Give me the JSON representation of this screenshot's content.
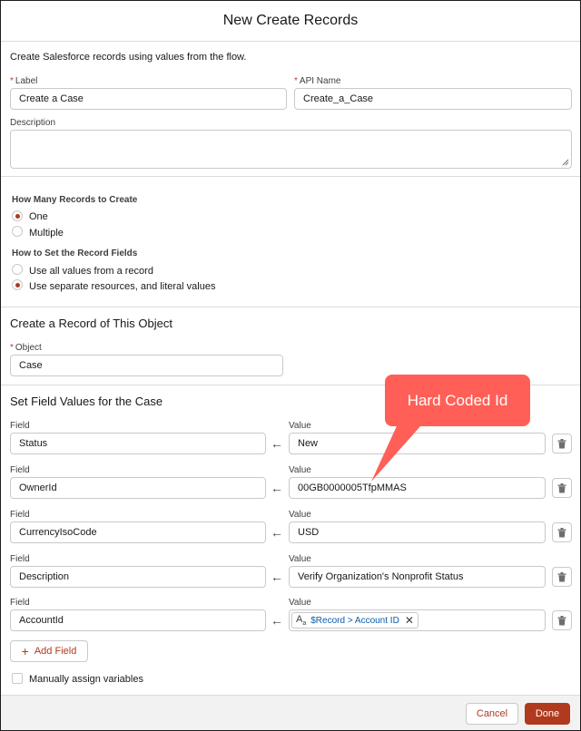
{
  "modal": {
    "title": "New Create Records"
  },
  "intro": "Create Salesforce records using values from the flow.",
  "label_field": {
    "label": "Label",
    "value": "Create a Case"
  },
  "api_field": {
    "label": "API Name",
    "value": "Create_a_Case"
  },
  "description_field": {
    "label": "Description",
    "value": ""
  },
  "how_many": {
    "label": "How Many Records to Create",
    "options": [
      {
        "label": "One",
        "selected": true
      },
      {
        "label": "Multiple",
        "selected": false
      }
    ]
  },
  "how_set": {
    "label": "How to Set the Record Fields",
    "options": [
      {
        "label": "Use all values from a record",
        "selected": false
      },
      {
        "label": "Use separate resources, and literal values",
        "selected": true
      }
    ]
  },
  "object_section": {
    "title": "Create a Record of This Object",
    "object_label": "Object",
    "object_value": "Case"
  },
  "field_values": {
    "title": "Set Field Values for the Case",
    "field_label": "Field",
    "value_label": "Value",
    "rows": [
      {
        "field": "Status",
        "value": "New"
      },
      {
        "field": "OwnerId",
        "value": "00GB0000005TfpMMAS"
      },
      {
        "field": "CurrencyIsoCode",
        "value": "USD"
      },
      {
        "field": "Description",
        "value": "Verify Organization's Nonprofit Status"
      },
      {
        "field": "AccountId",
        "value": "$Record > Account ID"
      }
    ]
  },
  "add_field_label": "Add Field",
  "manual_assign_label": "Manually assign variables",
  "callout_text": "Hard Coded Id",
  "footer": {
    "cancel_label": "Cancel",
    "done_label": "Done"
  },
  "colors": {
    "brand": "#b03a1d",
    "callout": "#ff5f57",
    "link": "#0b5cab"
  },
  "icons": {
    "arrow": "left-arrow-icon",
    "delete": "trash-icon",
    "resource_type": "text-type-icon",
    "remove": "close-icon",
    "add": "plus-icon"
  }
}
